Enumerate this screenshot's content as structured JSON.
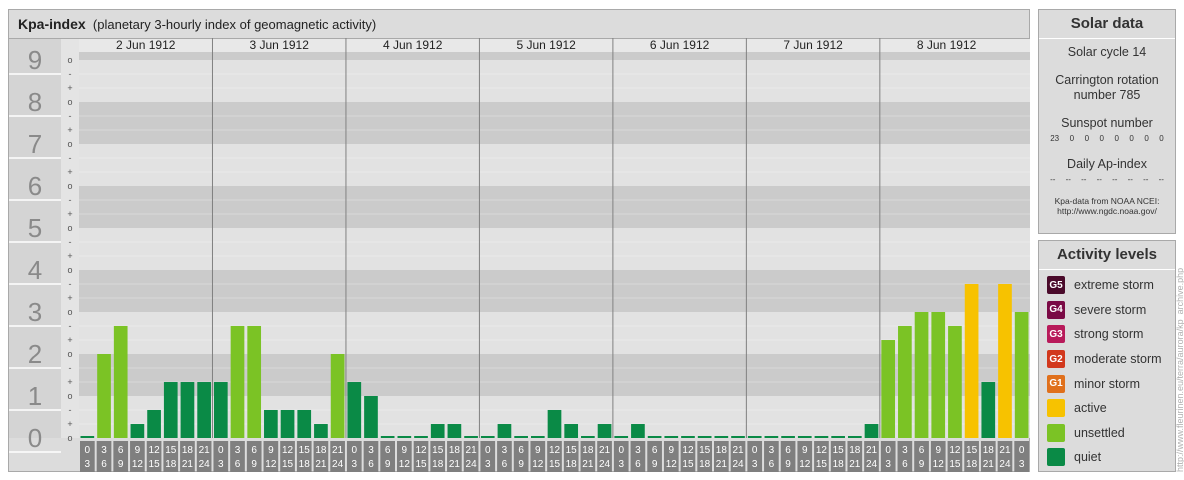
{
  "title": {
    "bold": "Kpa-index",
    "subtitle": "(planetary 3-hourly index of geomagnetic activity)"
  },
  "chart_data": {
    "type": "bar",
    "ylim": [
      0,
      9
    ],
    "y_major_ticks": [
      "0",
      "1",
      "2",
      "3",
      "4",
      "5",
      "6",
      "7",
      "8",
      "9"
    ],
    "y_minor_labels": [
      "o",
      "+",
      "-"
    ],
    "days": [
      "2 Jun 1912",
      "3 Jun 1912",
      "4 Jun 1912",
      "5 Jun 1912",
      "6 Jun 1912",
      "7 Jun 1912",
      "8 Jun 1912"
    ],
    "interval_start_labels": [
      "0",
      "3",
      "6",
      "9",
      "12",
      "15",
      "18",
      "21"
    ],
    "interval_end_labels": [
      "3",
      "6",
      "9",
      "12",
      "15",
      "18",
      "21",
      "24"
    ],
    "values": [
      0,
      2.0,
      2.667,
      0.333,
      0.667,
      1.333,
      1.333,
      1.333,
      1.333,
      2.667,
      2.667,
      0.667,
      0.667,
      0.667,
      0.333,
      2.0,
      1.333,
      1.0,
      0,
      0,
      0,
      0.333,
      0.333,
      0,
      0,
      0.333,
      0,
      0,
      0.667,
      0.333,
      0,
      0.333,
      0,
      0.333,
      0,
      0,
      0,
      0,
      0,
      0,
      0,
      0,
      0,
      0,
      0,
      0,
      0,
      0.333,
      2.333,
      2.667,
      3.0,
      3.0,
      2.667,
      3.667,
      1.333,
      3.667,
      3.0
    ],
    "bar_colors": {
      "quiet": "#0a8a46",
      "unsettled": "#7bc325",
      "active": "#f7c200"
    }
  },
  "solar": {
    "title": "Solar data",
    "cycle": "Solar cycle 14",
    "carrington": "Carrington rotation number 785",
    "sunspot_title": "Sunspot number",
    "sunspot_values": [
      "23",
      "0",
      "0",
      "0",
      "0",
      "0",
      "0",
      "0"
    ],
    "ap_title": "Daily Ap-index",
    "ap_values": [
      "--",
      "--",
      "--",
      "--",
      "--",
      "--",
      "--",
      "--"
    ],
    "source": "Kpa-data from NOAA NCEI:",
    "source_url": "http://www.ngdc.noaa.gov/"
  },
  "activity": {
    "title": "Activity levels",
    "items": [
      {
        "code": "G5",
        "label": "extreme storm",
        "color": "#4a0a2a"
      },
      {
        "code": "G4",
        "label": "severe storm",
        "color": "#7a0a45"
      },
      {
        "code": "G3",
        "label": "strong storm",
        "color": "#b81a5a"
      },
      {
        "code": "G2",
        "label": "moderate storm",
        "color": "#d2381c"
      },
      {
        "code": "G1",
        "label": "minor storm",
        "color": "#e0701c"
      },
      {
        "code": "",
        "label": "active",
        "color": "#f7c200"
      },
      {
        "code": "",
        "label": "unsettled",
        "color": "#7bc325"
      },
      {
        "code": "",
        "label": "quiet",
        "color": "#0a8a46"
      }
    ]
  },
  "watermark": "http://www.fleurinen.eu/terra/aurora/kp_archive.php"
}
